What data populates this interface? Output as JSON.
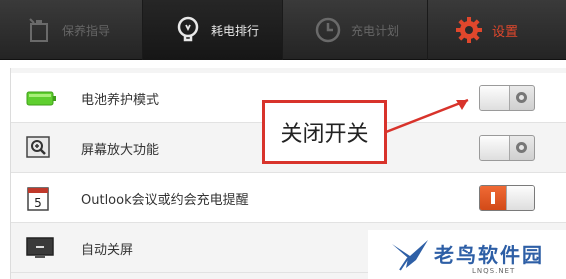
{
  "tabs": [
    {
      "label": "保养指导",
      "icon": "battery-care-icon",
      "active": false
    },
    {
      "label": "耗电排行",
      "icon": "lightbulb-icon",
      "active": true
    },
    {
      "label": "充电计划",
      "icon": "clock-icon",
      "active": false
    },
    {
      "label": "设置",
      "icon": "gear-icon",
      "active": false,
      "color": "#e0472c"
    }
  ],
  "settings": [
    {
      "label": "电池养护模式",
      "icon": "green-battery-icon",
      "toggle": "off"
    },
    {
      "label": "屏幕放大功能",
      "icon": "magnifier-icon",
      "toggle": "off"
    },
    {
      "label": "Outlook会议或约会充电提醒",
      "icon": "calendar-icon",
      "calendar_day": "5",
      "toggle": "on"
    },
    {
      "label": "自动关屏",
      "icon": "monitor-icon"
    }
  ],
  "annotation": {
    "text": "关闭开关",
    "color": "#d8332b"
  },
  "watermark": {
    "name": "老鸟软件园",
    "site": "LNQS.NET"
  }
}
